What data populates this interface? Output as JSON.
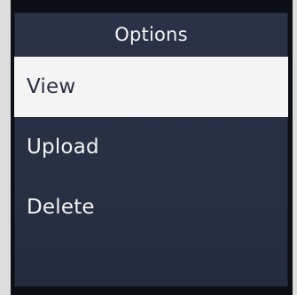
{
  "screen": {
    "title": "Options",
    "menu": {
      "items": [
        {
          "label": "View",
          "selected": true
        },
        {
          "label": "Upload",
          "selected": false
        },
        {
          "label": "Delete",
          "selected": false
        }
      ]
    }
  }
}
